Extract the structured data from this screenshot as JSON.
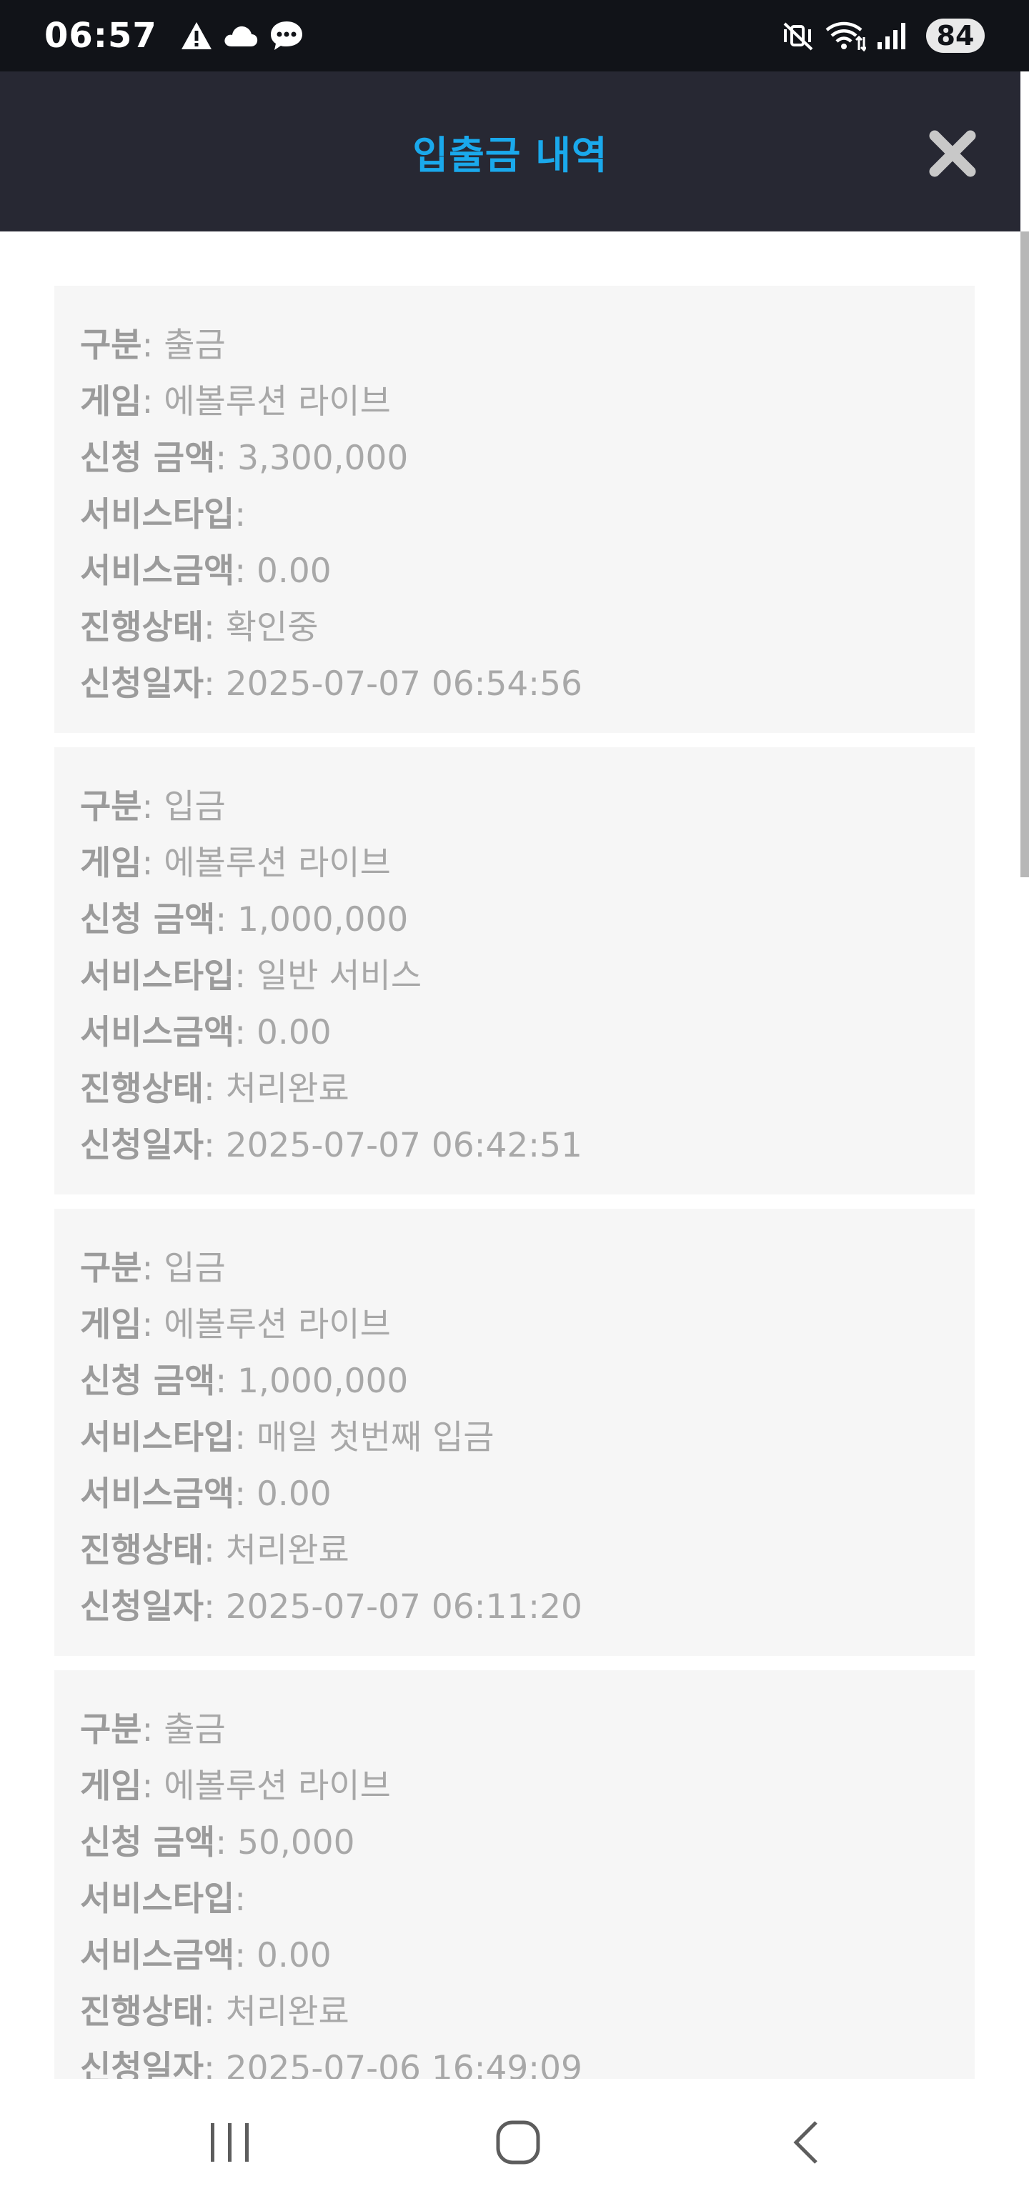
{
  "status_bar": {
    "time": "06:57",
    "battery": "84"
  },
  "header": {
    "title": "입출금 내역"
  },
  "labels": {
    "type": "구분",
    "game": "게임",
    "amount": "신청 금액",
    "service_type": "서비스타입",
    "service_amount": "서비스금액",
    "status": "진행상태",
    "date": "신청일자"
  },
  "records": [
    {
      "type": "출금",
      "game": "에볼루션 라이브",
      "amount": "3,300,000",
      "service_type": "",
      "service_amount": "0.00",
      "status": "확인중",
      "date": "2025-07-07 06:54:56"
    },
    {
      "type": "입금",
      "game": "에볼루션 라이브",
      "amount": "1,000,000",
      "service_type": "일반 서비스",
      "service_amount": "0.00",
      "status": "처리완료",
      "date": "2025-07-07 06:42:51"
    },
    {
      "type": "입금",
      "game": "에볼루션 라이브",
      "amount": "1,000,000",
      "service_type": "매일 첫번째 입금",
      "service_amount": "0.00",
      "status": "처리완료",
      "date": "2025-07-07 06:11:20"
    },
    {
      "type": "출금",
      "game": "에볼루션 라이브",
      "amount": "50,000",
      "service_type": "",
      "service_amount": "0.00",
      "status": "처리완료",
      "date": "2025-07-06 16:49:09"
    }
  ],
  "colors": {
    "status_bar_bg": "#111318",
    "header_bg": "#272833",
    "title_color": "#1aa9ec",
    "card_bg": "#f6f6f6",
    "text_gray": "#a5a5a5"
  },
  "icons": {
    "status_left": [
      "warning-icon",
      "cloud-icon",
      "chat-bubble-icon"
    ],
    "status_right": [
      "mute-vibrate-icon",
      "wifi-icon",
      "signal-icon"
    ],
    "header": "close-icon",
    "nav": [
      "recent-apps-icon",
      "home-icon",
      "back-icon"
    ]
  }
}
